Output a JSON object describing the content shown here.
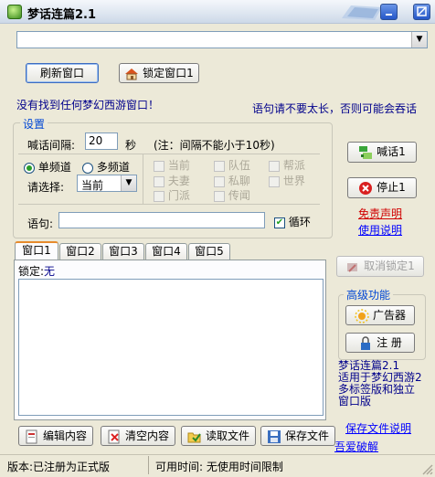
{
  "window": {
    "title": "梦话连篇2.1"
  },
  "buttons": {
    "refresh": "刷新窗口",
    "lock_window": "锁定窗口1",
    "shout": "喊话1",
    "stop": "停止1",
    "cancel_lock": "取消锁定1",
    "ads": "广告器",
    "register": "注 册",
    "edit": "编辑内容",
    "clear": "清空内容",
    "read_file": "读取文件",
    "save_file": "保存文件"
  },
  "messages": {
    "not_found": "没有找到任何梦幻西游窗口！",
    "warning": "语句请不要太长，否则可能会吞话"
  },
  "settings": {
    "legend": "设置",
    "interval_label": "喊话间隔:",
    "interval_value": "20",
    "interval_unit": "秒",
    "interval_note": "(注：间隔不能小于10秒)",
    "single_channel": "单频道",
    "multi_channel": "多频道",
    "select_label": "请选择:",
    "select_value": "当前",
    "channels": [
      "当前",
      "队伍",
      "帮派",
      "夫妻",
      "私聊",
      "世界",
      "门派",
      "传闻"
    ],
    "sentence_label": "语句:",
    "sentence_value": "",
    "loop_label": "循环"
  },
  "links": {
    "disclaimer": "免责声明",
    "usage": "使用说明",
    "save_file_help": "保存文件说明",
    "wuai": "吾爱破解"
  },
  "tabs": [
    "窗口1",
    "窗口2",
    "窗口3",
    "窗口4",
    "窗口5"
  ],
  "lock_status": {
    "label": "锁定:",
    "value": "无"
  },
  "advanced": {
    "legend": "高级功能",
    "info_line1": "梦话连篇2.1",
    "info_line2": "适用于梦幻西游2",
    "info_line3": "多标签版和独立",
    "info_line4": "窗口版"
  },
  "status": {
    "version": "版本:已注册为正式版",
    "time": "可用时间: 无使用时间限制"
  }
}
